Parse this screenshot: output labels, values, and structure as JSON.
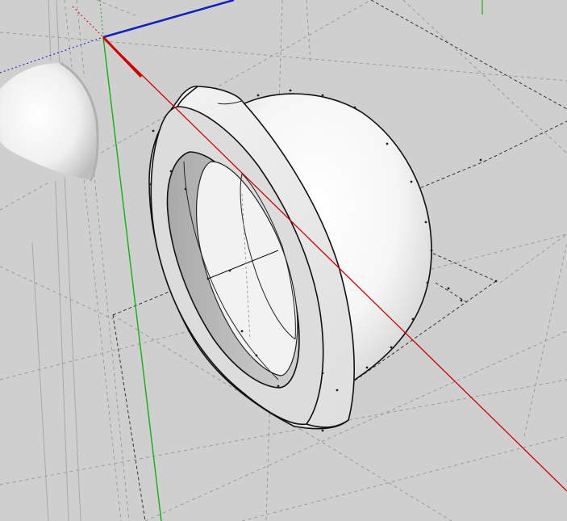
{
  "viewport": {
    "background": "#cfcfcf",
    "axes": {
      "red_color": "#d00000",
      "green_color": "#10b010",
      "blue_color": "#1020c0"
    },
    "objects": [
      {
        "name": "dome-cap-with-rim",
        "material_color": "#ffffff"
      },
      {
        "name": "dome-copy",
        "material_color": "#ffffff"
      }
    ]
  }
}
